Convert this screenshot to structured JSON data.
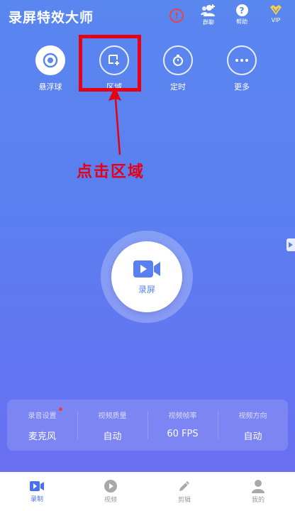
{
  "header": {
    "title": "录屏特效大师",
    "alert_icon_text": "!",
    "buttons": [
      {
        "label": "群聊",
        "icon": "group-icon"
      },
      {
        "label": "帮助",
        "icon": "help-icon"
      },
      {
        "label": "VIP",
        "icon": "vip-icon"
      }
    ]
  },
  "tools": [
    {
      "label": "悬浮球",
      "icon": "floating-ball-icon"
    },
    {
      "label": "区域",
      "icon": "region-icon"
    },
    {
      "label": "定时",
      "icon": "timer-icon"
    },
    {
      "label": "更多",
      "icon": "more-icon"
    }
  ],
  "annotation": {
    "text": "点击区域",
    "color": "#e60012"
  },
  "record": {
    "label": "录屏"
  },
  "settings": [
    {
      "title": "录音设置",
      "value": "麦克风"
    },
    {
      "title": "视频质量",
      "value": "自动"
    },
    {
      "title": "视频帧率",
      "value": "60 FPS"
    },
    {
      "title": "视频方向",
      "value": "自动"
    }
  ],
  "nav": [
    {
      "label": "录制",
      "icon": "record-icon",
      "active": true
    },
    {
      "label": "视频",
      "icon": "video-icon",
      "active": false
    },
    {
      "label": "剪辑",
      "icon": "edit-icon",
      "active": false
    },
    {
      "label": "我的",
      "icon": "user-icon",
      "active": false
    }
  ],
  "colors": {
    "accent": "#4a6ff0",
    "background_top": "#5a86f0",
    "background_bottom": "#6a6ff2"
  }
}
